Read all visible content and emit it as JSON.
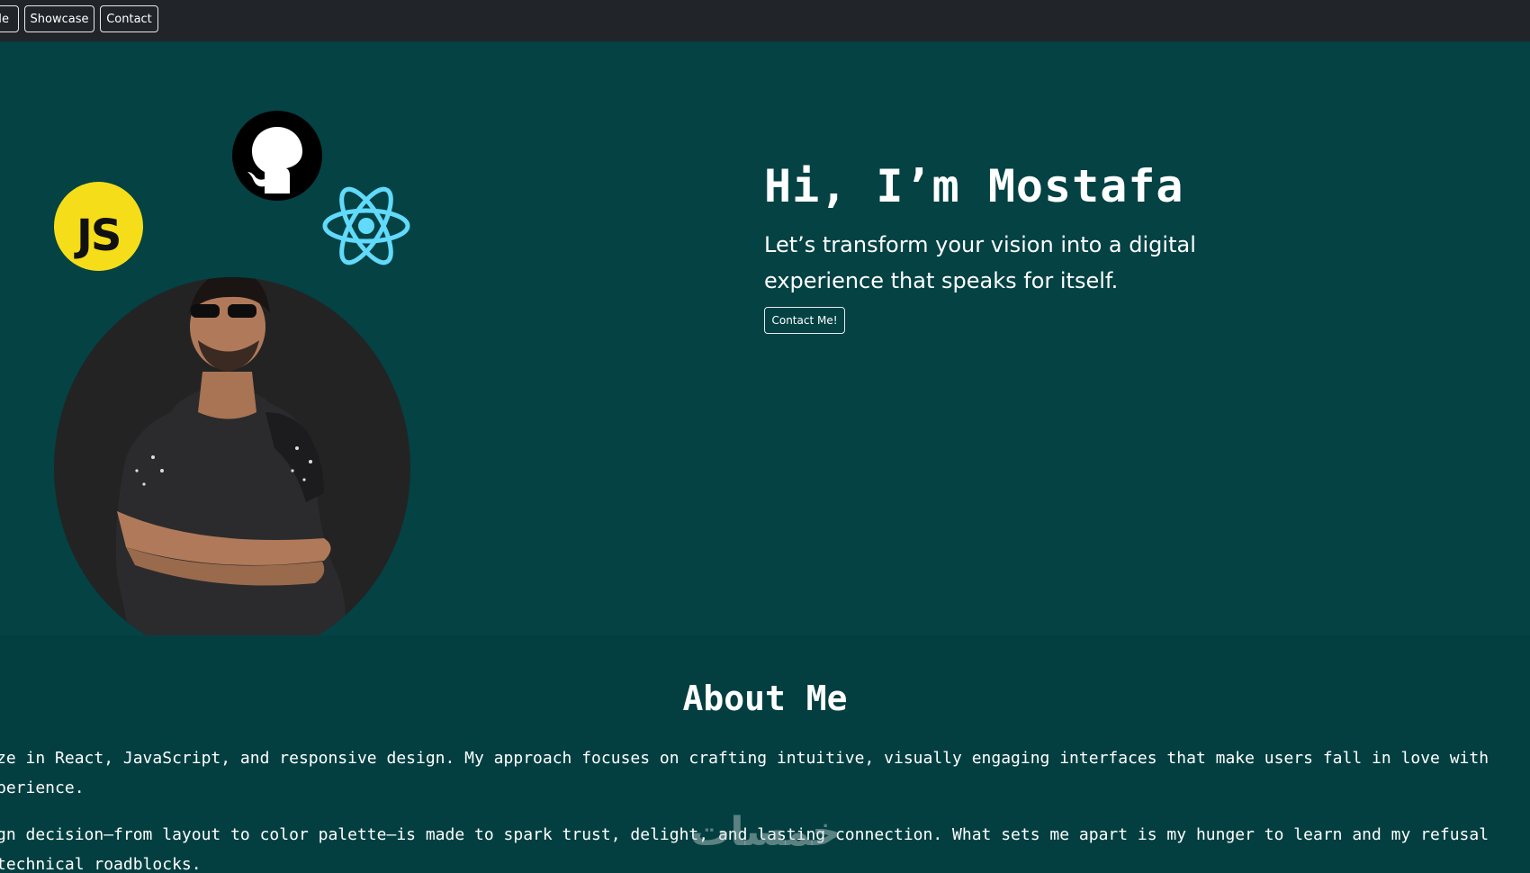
{
  "navbar": {
    "items": [
      {
        "label": "Me"
      },
      {
        "label": "Showcase"
      },
      {
        "label": "Contact"
      }
    ]
  },
  "hero": {
    "title": "Hi, I’m Mostafa",
    "subtitle": "Let’s transform your vision into a digital experience that speaks for itself.",
    "cta_label": "Contact Me!",
    "badges": {
      "js_label": "JS",
      "js_icon": "javascript-icon",
      "github_icon": "github-icon",
      "react_icon": "react-icon"
    }
  },
  "about": {
    "title": "About Me",
    "paragraph_1_line_1": "ze in React, JavaScript, and responsive design. My approach focuses on crafting intuitive, visually engaging interfaces that make users fall in love with",
    "paragraph_1_line_2": "perience.",
    "paragraph_2_line_1": "gn decision—from layout to color palette—is made to spark trust, delight, and lasting connection. What sets me apart is my hunger to learn and my refusal",
    "paragraph_2_line_2": " technical roadblocks."
  },
  "watermark": {
    "text": "خمسات"
  },
  "colors": {
    "navbar_bg": "#212529",
    "hero_bg": "#044244",
    "about_bg": "#033f41",
    "js_yellow": "#f5de19",
    "react_cyan": "#61dafb",
    "photo_circle": "#232323"
  }
}
